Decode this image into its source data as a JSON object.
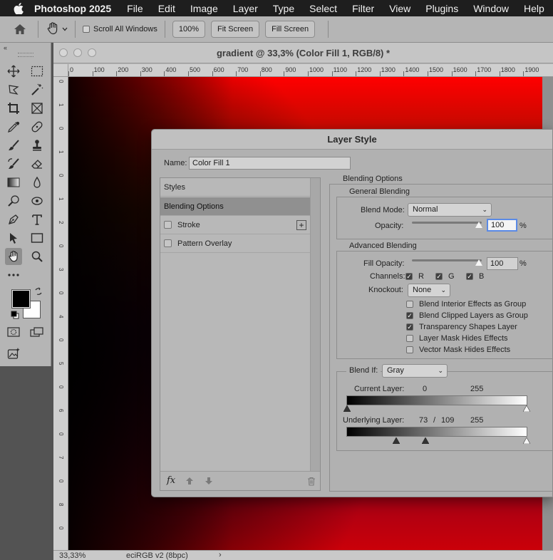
{
  "menubar": {
    "app_name": "Photoshop 2025",
    "items": [
      "File",
      "Edit",
      "Image",
      "Layer",
      "Type",
      "Select",
      "Filter",
      "View",
      "Plugins",
      "Window",
      "Help"
    ]
  },
  "options_bar": {
    "scroll_all_windows_label": "Scroll All Windows",
    "zoom_button": "100%",
    "fit_screen_button": "Fit Screen",
    "fill_screen_button": "Fill Screen"
  },
  "toolbar": {
    "collapse_label": "«"
  },
  "document": {
    "title": "gradient @ 33,3% (Color Fill 1, RGB/8) *",
    "ruler_h_labels": [
      "0",
      "100",
      "200",
      "300",
      "400",
      "500",
      "600",
      "700",
      "800",
      "900",
      "1000",
      "1100",
      "1200",
      "1300",
      "1400",
      "1500",
      "1600",
      "1700",
      "1800",
      "1900"
    ],
    "ruler_v_labels": [
      "0",
      "1",
      "0",
      "1",
      "0",
      "1",
      "2",
      "0",
      "3",
      "0",
      "4",
      "0",
      "5",
      "0",
      "6",
      "0",
      "7",
      "0",
      "8",
      "0"
    ],
    "fill_color": "#ff0000"
  },
  "status": {
    "zoom": "33,33%",
    "profile": "eciRGB v2 (8bpc)",
    "arrow": "›"
  },
  "layer_style": {
    "title": "Layer Style",
    "name_label": "Name:",
    "name_value": "Color Fill 1",
    "styles_header": "Styles",
    "styles": [
      {
        "label": "Blending Options",
        "selected": true
      },
      {
        "label": "Stroke",
        "checkbox": true,
        "has_add": true
      },
      {
        "label": "Pattern Overlay",
        "checkbox": true
      }
    ],
    "blending_options_header": "Blending Options",
    "general_blending": {
      "legend": "General Blending",
      "blend_mode_label": "Blend Mode:",
      "blend_mode_value": "Normal",
      "opacity_label": "Opacity:",
      "opacity_value": "100",
      "percent": "%"
    },
    "advanced_blending": {
      "legend": "Advanced Blending",
      "fill_opacity_label": "Fill Opacity:",
      "fill_opacity_value": "100",
      "percent": "%",
      "channels_label": "Channels:",
      "channels": [
        "R",
        "G",
        "B"
      ],
      "knockout_label": "Knockout:",
      "knockout_value": "None",
      "options": [
        {
          "label": "Blend Interior Effects as Group",
          "checked": false
        },
        {
          "label": "Blend Clipped Layers as Group",
          "checked": true
        },
        {
          "label": "Transparency Shapes Layer",
          "checked": true
        },
        {
          "label": "Layer Mask Hides Effects",
          "checked": false
        },
        {
          "label": "Vector Mask Hides Effects",
          "checked": false
        }
      ]
    },
    "blend_if": {
      "label": "Blend If:",
      "value": "Gray",
      "current_layer_label": "Current Layer:",
      "current_low": "0",
      "current_high": "255",
      "underlying_layer_label": "Underlying Layer:",
      "underlying_low_a": "73",
      "underlying_sep": "/",
      "underlying_low_b": "109",
      "underlying_high": "255"
    },
    "footer": {
      "fx_label": "fx"
    }
  }
}
